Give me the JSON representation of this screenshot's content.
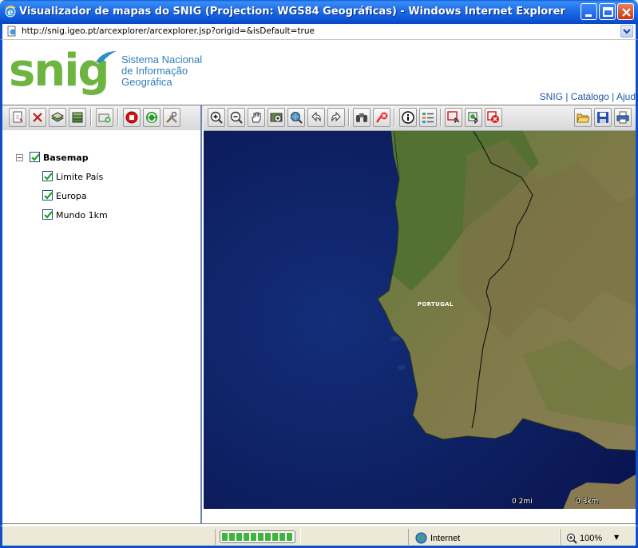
{
  "window": {
    "title": "Visualizador de mapas do SNIG (Projection: WGS84 Geográficas) - Windows Internet Explorer"
  },
  "address": {
    "url": "http://snig.igeo.pt/arcexplorer/arcexplorer.jsp?origid=&isDefault=true"
  },
  "header": {
    "logo_text": "snig",
    "logo_sub_1": "Sistema Nacional",
    "logo_sub_2": "de Informação",
    "logo_sub_3": "Geográfica",
    "links": [
      "SNIG",
      "Catálogo",
      "Ajud"
    ],
    "link_sep": " | "
  },
  "layers": {
    "root_label": "Basemap",
    "items": [
      {
        "label": "Limite País",
        "checked": true
      },
      {
        "label": "Europa",
        "checked": true
      },
      {
        "label": "Mundo 1km",
        "checked": true
      }
    ]
  },
  "map": {
    "country_label": "PORTUGAL",
    "scale_left": "0 2mi",
    "scale_right": "0 3km"
  },
  "status": {
    "zone": "Internet",
    "zoom": "100%",
    "progress_pct": 100
  },
  "colors": {
    "logo_green": "#6eb441",
    "logo_blue": "#2e8fc9",
    "link_blue": "#1f57a3",
    "ocean": "#0b1a5c"
  }
}
